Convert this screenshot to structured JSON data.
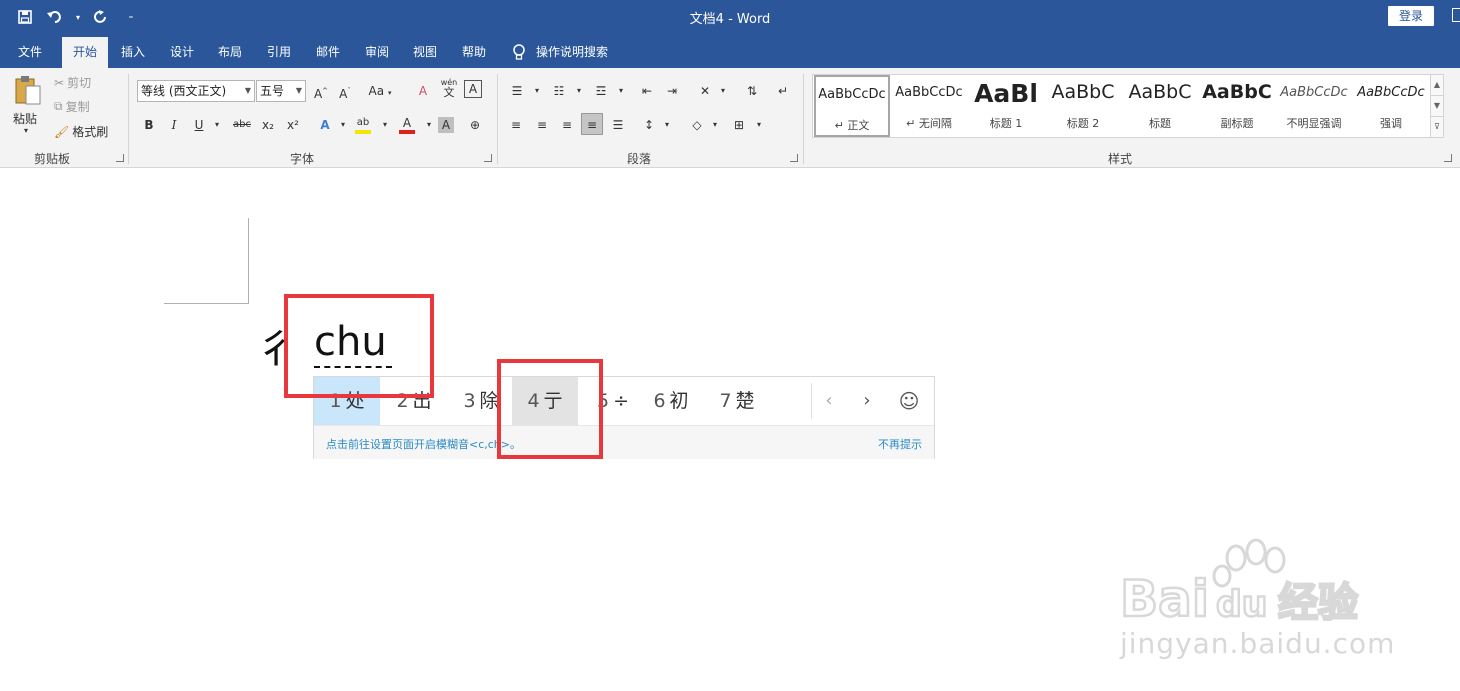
{
  "titlebar": {
    "doc_title": "文档4  -  Word",
    "login_label": "登录"
  },
  "tabs": [
    {
      "label": "文件",
      "active": false
    },
    {
      "label": "开始",
      "active": true
    },
    {
      "label": "插入",
      "active": false
    },
    {
      "label": "设计",
      "active": false
    },
    {
      "label": "布局",
      "active": false
    },
    {
      "label": "引用",
      "active": false
    },
    {
      "label": "邮件",
      "active": false
    },
    {
      "label": "审阅",
      "active": false
    },
    {
      "label": "视图",
      "active": false
    },
    {
      "label": "帮助",
      "active": false
    }
  ],
  "tell_me": "操作说明搜索",
  "clipboard": {
    "paste": "粘贴",
    "cut": "剪切",
    "copy": "复制",
    "format_painter": "格式刷",
    "label": "剪贴板"
  },
  "font": {
    "font_name": "等线 (西文正文)",
    "font_size": "五号",
    "label": "字体",
    "change_case": "Aa",
    "bold": "B",
    "italic": "I",
    "underline": "U",
    "strike": "abc",
    "subscript": "x₂",
    "superscript": "x²",
    "phonetic_top": "wén",
    "phonetic_bottom": "文",
    "char_border": "A",
    "text_effect": "A",
    "font_color": "A",
    "char_shading": "A",
    "highlight": "ab"
  },
  "paragraph": {
    "label": "段落"
  },
  "styles": {
    "label": "样式",
    "items": [
      {
        "sample": "AaBbCcDc",
        "name": "↵ 正文",
        "selected": true
      },
      {
        "sample": "AaBbCcDc",
        "name": "↵ 无间隔",
        "selected": false
      },
      {
        "sample": "AaBl",
        "name": "标题 1",
        "selected": false
      },
      {
        "sample": "AaBbC",
        "name": "标题 2",
        "selected": false
      },
      {
        "sample": "AaBbC",
        "name": "标题",
        "selected": false
      },
      {
        "sample": "AaBbC",
        "name": "副标题",
        "selected": false
      },
      {
        "sample": "AaBbCcDc",
        "name": "不明显强调",
        "selected": false
      },
      {
        "sample": "AaBbCcDc",
        "name": "强调",
        "selected": false
      }
    ]
  },
  "document": {
    "partial_char": "彳",
    "composition": "chu"
  },
  "ime": {
    "candidates": [
      {
        "num": "1",
        "char": "处"
      },
      {
        "num": "2",
        "char": "出"
      },
      {
        "num": "3",
        "char": "除"
      },
      {
        "num": "4",
        "char": "亍"
      },
      {
        "num": "5",
        "char": "÷"
      },
      {
        "num": "6",
        "char": "初"
      },
      {
        "num": "7",
        "char": "楚"
      }
    ],
    "prev": "‹",
    "next": "›",
    "emoji": "☺",
    "hint": "点击前往设置页面开启模糊音<c,ch>。",
    "dismiss": "不再提示"
  },
  "watermark": {
    "brand": "Bai du 经验",
    "url": "jingyan.baidu.com"
  },
  "colors": {
    "word_blue": "#2b579a",
    "annotation_red": "#e8383d",
    "candidate_highlight": "#c9e6fb"
  }
}
